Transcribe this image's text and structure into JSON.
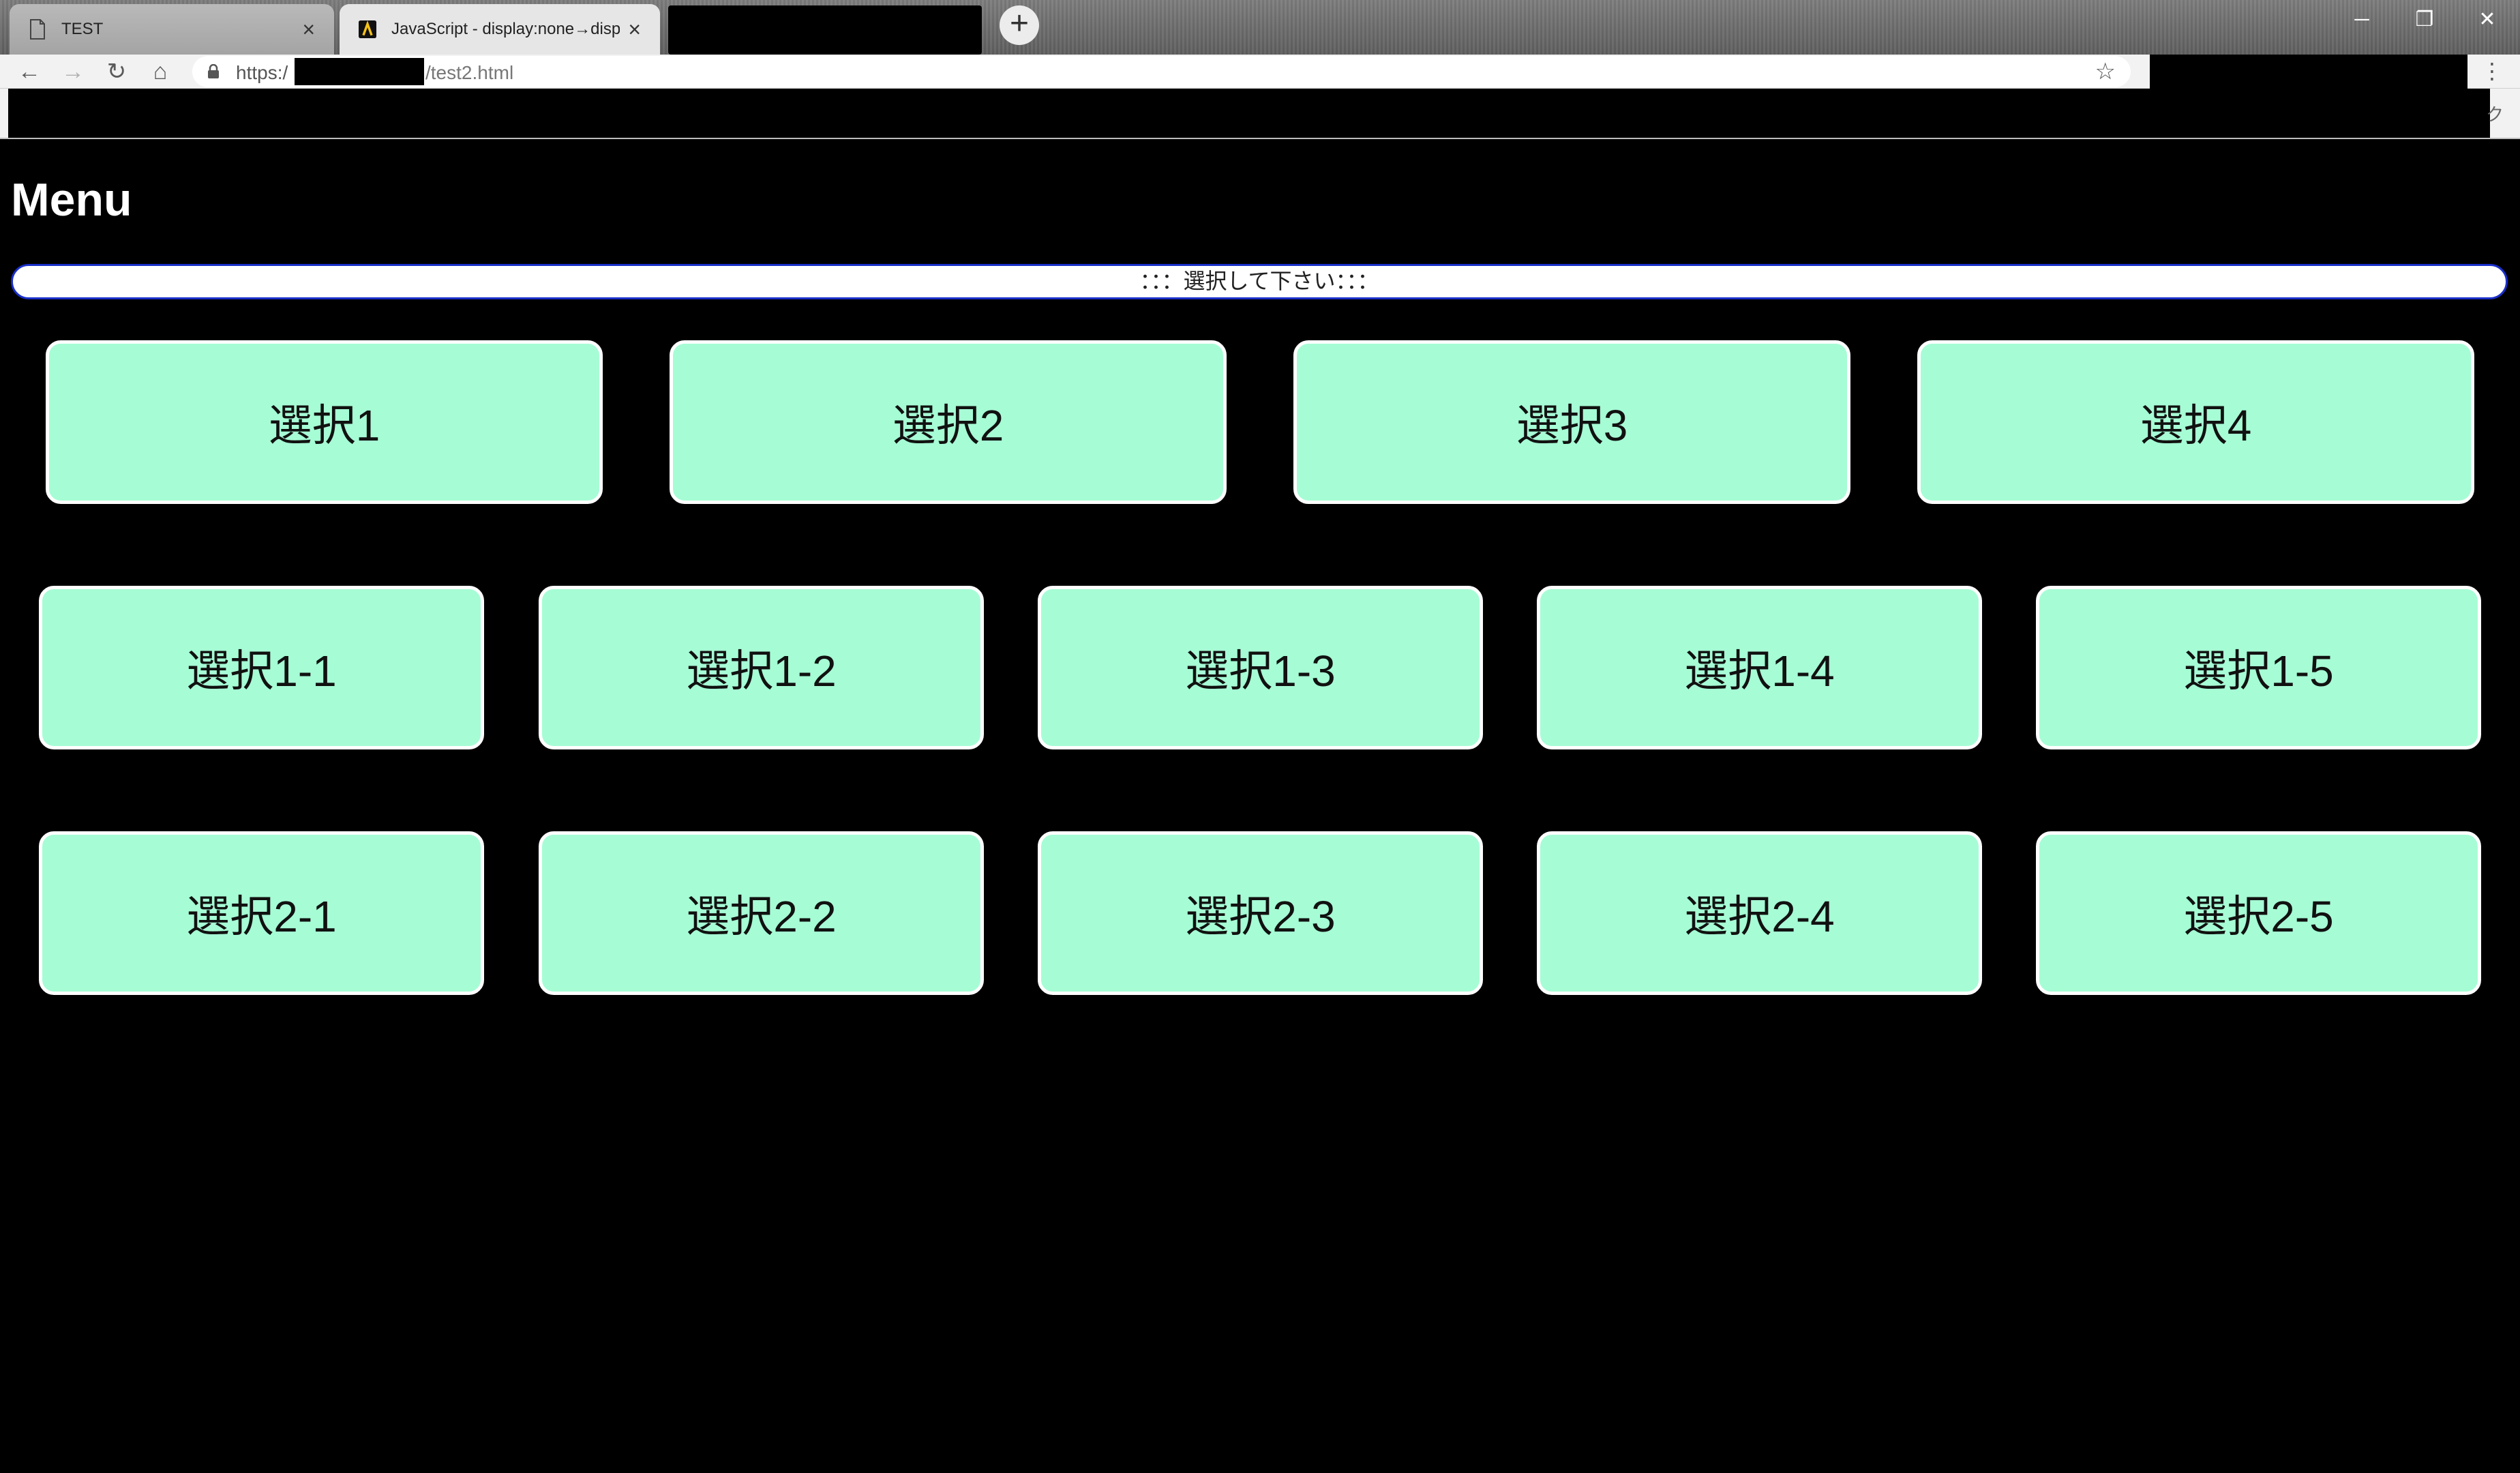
{
  "browser": {
    "tabs": [
      {
        "label": "TEST",
        "close": "×"
      },
      {
        "label": "JavaScript - display:none→displa",
        "close": "×"
      }
    ],
    "new_tab": "+",
    "window_controls": {
      "minimize": "─",
      "restore": "❐",
      "close": "✕"
    },
    "nav": {
      "back": "←",
      "forward": "→",
      "reload": "↻",
      "home": "⌂"
    },
    "url": {
      "prefix": "https:/",
      "path": "/test2.html"
    },
    "star": "☆",
    "menu": "⋮",
    "bookmark_tail": "ク"
  },
  "page": {
    "title": "Menu",
    "prompt": "：：：選択して下さい：：：",
    "row1": [
      "選択1",
      "選択2",
      "選択3",
      "選択4"
    ],
    "row2": [
      "選択1-1",
      "選択1-2",
      "選択1-3",
      "選択1-4",
      "選択1-5"
    ],
    "row3": [
      "選択2-1",
      "選択2-2",
      "選択2-3",
      "選択2-4",
      "選択2-5"
    ]
  },
  "colors": {
    "button_fill": "#a6fdd5",
    "prompt_border": "#1a2fc9",
    "page_background": "#000000"
  }
}
